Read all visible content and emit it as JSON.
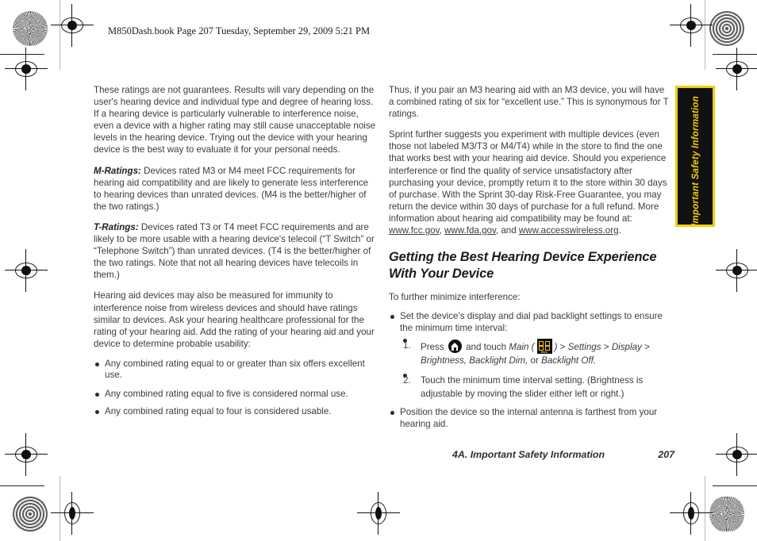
{
  "header": {
    "slug": "M850Dash.book  Page 207  Tuesday, September 29, 2009  5:21 PM"
  },
  "side_tab": {
    "label": "Important Safety Information",
    "background": "#111111",
    "border_color": "#f2cf00",
    "text_color": "#f2cf00"
  },
  "left_column": {
    "paragraphs": [
      "These ratings are not guarantees. Results will vary depending on the user's hearing device and individual type and degree of hearing loss. If a hearing device is particularly vulnerable to interference noise, even a device with a higher rating may still cause unacceptable noise levels in the hearing device. Trying out the device with your hearing device is the best way to evaluate it for your personal needs."
    ],
    "m_ratings": {
      "lead": "M-Ratings:",
      "body": " Devices rated M3 or M4 meet FCC requirements for hearing aid compatibility and are likely to generate less interference to hearing devices than unrated devices. (M4 is the better/higher of the two ratings.)"
    },
    "t_ratings": {
      "lead": "T-Ratings:",
      "body": " Devices rated T3 or T4 meet FCC requirements and are likely to be more usable with a hearing device's telecoil (“T Switch” or “Telephone Switch”) than unrated devices. (T4 is the better/higher of the two ratings. Note that not all hearing devices have telecoils in them.)"
    },
    "immunity_paragraph": "Hearing aid devices may also be measured for immunity to interference noise from wireless devices and should have ratings similar to devices. Ask your hearing healthcare professional for the rating of your hearing aid. Add the rating of your hearing aid and your device to determine probable usability:",
    "bullets": [
      "Any combined rating equal to or greater than six offers excellent use.",
      "Any combined rating equal to five is considered normal use.",
      "Any combined rating equal to four is considered usable."
    ]
  },
  "right_column": {
    "paragraph_1": "Thus, if you pair an M3 hearing aid with an M3 device, you will have a combined rating of six for “excellent use.” This is synonymous for T ratings.",
    "paragraph_2_part_1": "Sprint further suggests you experiment with multiple devices (even those not labeled M3/T3 or M4/T4) while in the store to find the one that works best with your hearing aid device. Should you experience interference or find the quality of service unsatisfactory after purchasing your device, promptly return it to the store within 30 days of purchase. With the Sprint 30-day Risk-Free Guarantee, you may return the device within 30 days of purchase for a full refund. More information about hearing aid compatibility may be found at: ",
    "link_1": "www.fcc.gov",
    "separator_1": ", ",
    "link_2": "www.fda.gov",
    "separator_2": ", and ",
    "link_3": "www.accesswireless.org",
    "separator_3": ".",
    "heading": "Getting the Best Hearing Device Experience With Your Device",
    "intro": "To further minimize interference:",
    "bullet_1": "Set the device's display and dial pad backlight settings to ensure the minimum time interval:",
    "step_1": {
      "press_label": "Press",
      "home_icon_name": "home-icon",
      "and_touch": "and touch",
      "menu_main": "Main",
      "open_paren": "(",
      "main_icon_name": "main-menu-icon",
      "main_icon_caption": "Main",
      "close_paren": ")",
      "chevron_1": ">",
      "menu_settings": "Settings",
      "chevron_2": ">",
      "menu_display": "Display",
      "chevron_3": ">",
      "menu_tail": "Brightness, Backlight  Dim,",
      "menu_or": "or",
      "menu_last": "Backlight Off."
    },
    "step_2": "Touch the minimum time interval setting. (Brightness is adjustable by moving the slider either left or right.)",
    "bullet_2": "Position the device so the internal antenna is farthest from your hearing aid."
  },
  "footer": {
    "chapter": "4A. Important Safety Information",
    "page_number": "207"
  }
}
